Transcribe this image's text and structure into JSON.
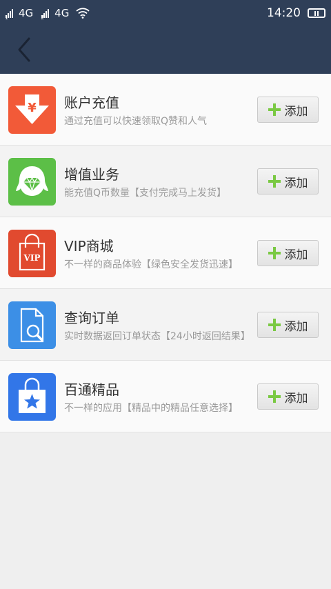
{
  "status_bar": {
    "sim1_label": "4G",
    "sim2_label": "4G",
    "time": "14:20"
  },
  "colors": {
    "header_bg": "#2f3f58",
    "add_plus": "#7ac943"
  },
  "items": [
    {
      "title": "账户充值",
      "description": "通过充值可以快速领取Q赞和人气",
      "icon": "yen-download-icon",
      "color": "#f25a38",
      "button_label": "添加"
    },
    {
      "title": "增值业务",
      "description": "能充值Q币数量【支付完成马上发货】",
      "icon": "penguin-diamond-icon",
      "color": "#5cbf47",
      "button_label": "添加"
    },
    {
      "title": "VIP商城",
      "description": "不一样的商品体验【绿色安全发货迅速】",
      "icon": "vip-bag-icon",
      "color": "#e14a2f",
      "button_label": "添加"
    },
    {
      "title": "查询订单",
      "description": "实时数据返回订单状态【24小时返回结果】",
      "icon": "document-search-icon",
      "color": "#3c8fe6",
      "button_label": "添加"
    },
    {
      "title": "百通精品",
      "description": "不一样的应用【精品中的精品任意选择】",
      "icon": "star-bag-icon",
      "color": "#3276e8",
      "button_label": "添加"
    }
  ]
}
